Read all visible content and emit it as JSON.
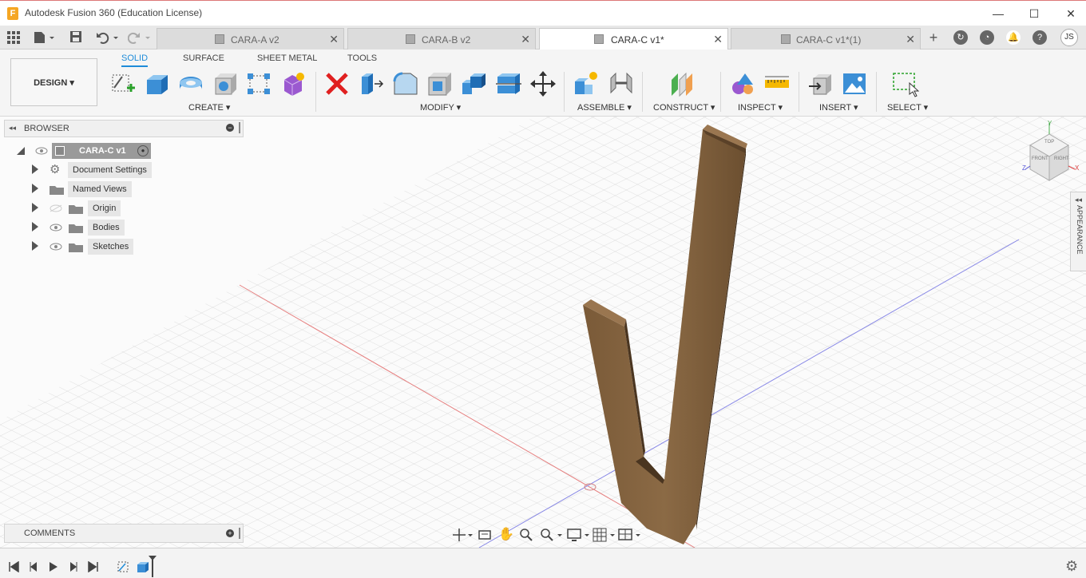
{
  "window": {
    "title": "Autodesk Fusion 360 (Education License)",
    "app_icon_letter": "F"
  },
  "tabs": [
    {
      "label": "CARA-A v2",
      "active": false
    },
    {
      "label": "CARA-B v2",
      "active": false
    },
    {
      "label": "CARA-C v1*",
      "active": true
    },
    {
      "label": "CARA-C v1*(1)",
      "active": false
    }
  ],
  "user_initials": "JS",
  "workspace": {
    "label": "DESIGN"
  },
  "ribbon_tabs": [
    "SOLID",
    "SURFACE",
    "SHEET METAL",
    "TOOLS"
  ],
  "ribbon_groups": {
    "create": "CREATE",
    "modify": "MODIFY",
    "assemble": "ASSEMBLE",
    "construct": "CONSTRUCT",
    "inspect": "INSPECT",
    "insert": "INSERT",
    "select": "SELECT"
  },
  "browser": {
    "title": "BROWSER",
    "root": "CARA-C v1",
    "items": [
      "Document Settings",
      "Named Views",
      "Origin",
      "Bodies",
      "Sketches"
    ]
  },
  "comments": {
    "title": "COMMENTS"
  },
  "appearance_panel": {
    "label": "APPEARANCE"
  },
  "viewcube": {
    "top": "TOP",
    "front": "FRONT",
    "right": "RIGHT",
    "axis_x": "X",
    "axis_y": "Y",
    "axis_z": "Z"
  },
  "colors": {
    "accent": "#1f8cd9",
    "wood": "#6e5233",
    "x_axis": "#e04040",
    "z_axis": "#5b5bdc"
  }
}
